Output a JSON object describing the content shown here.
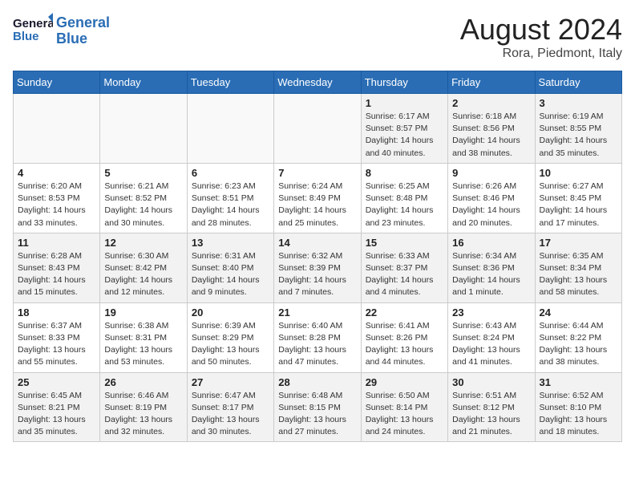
{
  "header": {
    "logo_line1": "General",
    "logo_line2": "Blue",
    "month": "August 2024",
    "location": "Rora, Piedmont, Italy"
  },
  "weekdays": [
    "Sunday",
    "Monday",
    "Tuesday",
    "Wednesday",
    "Thursday",
    "Friday",
    "Saturday"
  ],
  "weeks": [
    [
      {
        "day": "",
        "info": ""
      },
      {
        "day": "",
        "info": ""
      },
      {
        "day": "",
        "info": ""
      },
      {
        "day": "",
        "info": ""
      },
      {
        "day": "1",
        "info": "Sunrise: 6:17 AM\nSunset: 8:57 PM\nDaylight: 14 hours\nand 40 minutes."
      },
      {
        "day": "2",
        "info": "Sunrise: 6:18 AM\nSunset: 8:56 PM\nDaylight: 14 hours\nand 38 minutes."
      },
      {
        "day": "3",
        "info": "Sunrise: 6:19 AM\nSunset: 8:55 PM\nDaylight: 14 hours\nand 35 minutes."
      }
    ],
    [
      {
        "day": "4",
        "info": "Sunrise: 6:20 AM\nSunset: 8:53 PM\nDaylight: 14 hours\nand 33 minutes."
      },
      {
        "day": "5",
        "info": "Sunrise: 6:21 AM\nSunset: 8:52 PM\nDaylight: 14 hours\nand 30 minutes."
      },
      {
        "day": "6",
        "info": "Sunrise: 6:23 AM\nSunset: 8:51 PM\nDaylight: 14 hours\nand 28 minutes."
      },
      {
        "day": "7",
        "info": "Sunrise: 6:24 AM\nSunset: 8:49 PM\nDaylight: 14 hours\nand 25 minutes."
      },
      {
        "day": "8",
        "info": "Sunrise: 6:25 AM\nSunset: 8:48 PM\nDaylight: 14 hours\nand 23 minutes."
      },
      {
        "day": "9",
        "info": "Sunrise: 6:26 AM\nSunset: 8:46 PM\nDaylight: 14 hours\nand 20 minutes."
      },
      {
        "day": "10",
        "info": "Sunrise: 6:27 AM\nSunset: 8:45 PM\nDaylight: 14 hours\nand 17 minutes."
      }
    ],
    [
      {
        "day": "11",
        "info": "Sunrise: 6:28 AM\nSunset: 8:43 PM\nDaylight: 14 hours\nand 15 minutes."
      },
      {
        "day": "12",
        "info": "Sunrise: 6:30 AM\nSunset: 8:42 PM\nDaylight: 14 hours\nand 12 minutes."
      },
      {
        "day": "13",
        "info": "Sunrise: 6:31 AM\nSunset: 8:40 PM\nDaylight: 14 hours\nand 9 minutes."
      },
      {
        "day": "14",
        "info": "Sunrise: 6:32 AM\nSunset: 8:39 PM\nDaylight: 14 hours\nand 7 minutes."
      },
      {
        "day": "15",
        "info": "Sunrise: 6:33 AM\nSunset: 8:37 PM\nDaylight: 14 hours\nand 4 minutes."
      },
      {
        "day": "16",
        "info": "Sunrise: 6:34 AM\nSunset: 8:36 PM\nDaylight: 14 hours\nand 1 minute."
      },
      {
        "day": "17",
        "info": "Sunrise: 6:35 AM\nSunset: 8:34 PM\nDaylight: 13 hours\nand 58 minutes."
      }
    ],
    [
      {
        "day": "18",
        "info": "Sunrise: 6:37 AM\nSunset: 8:33 PM\nDaylight: 13 hours\nand 55 minutes."
      },
      {
        "day": "19",
        "info": "Sunrise: 6:38 AM\nSunset: 8:31 PM\nDaylight: 13 hours\nand 53 minutes."
      },
      {
        "day": "20",
        "info": "Sunrise: 6:39 AM\nSunset: 8:29 PM\nDaylight: 13 hours\nand 50 minutes."
      },
      {
        "day": "21",
        "info": "Sunrise: 6:40 AM\nSunset: 8:28 PM\nDaylight: 13 hours\nand 47 minutes."
      },
      {
        "day": "22",
        "info": "Sunrise: 6:41 AM\nSunset: 8:26 PM\nDaylight: 13 hours\nand 44 minutes."
      },
      {
        "day": "23",
        "info": "Sunrise: 6:43 AM\nSunset: 8:24 PM\nDaylight: 13 hours\nand 41 minutes."
      },
      {
        "day": "24",
        "info": "Sunrise: 6:44 AM\nSunset: 8:22 PM\nDaylight: 13 hours\nand 38 minutes."
      }
    ],
    [
      {
        "day": "25",
        "info": "Sunrise: 6:45 AM\nSunset: 8:21 PM\nDaylight: 13 hours\nand 35 minutes."
      },
      {
        "day": "26",
        "info": "Sunrise: 6:46 AM\nSunset: 8:19 PM\nDaylight: 13 hours\nand 32 minutes."
      },
      {
        "day": "27",
        "info": "Sunrise: 6:47 AM\nSunset: 8:17 PM\nDaylight: 13 hours\nand 30 minutes."
      },
      {
        "day": "28",
        "info": "Sunrise: 6:48 AM\nSunset: 8:15 PM\nDaylight: 13 hours\nand 27 minutes."
      },
      {
        "day": "29",
        "info": "Sunrise: 6:50 AM\nSunset: 8:14 PM\nDaylight: 13 hours\nand 24 minutes."
      },
      {
        "day": "30",
        "info": "Sunrise: 6:51 AM\nSunset: 8:12 PM\nDaylight: 13 hours\nand 21 minutes."
      },
      {
        "day": "31",
        "info": "Sunrise: 6:52 AM\nSunset: 8:10 PM\nDaylight: 13 hours\nand 18 minutes."
      }
    ]
  ]
}
